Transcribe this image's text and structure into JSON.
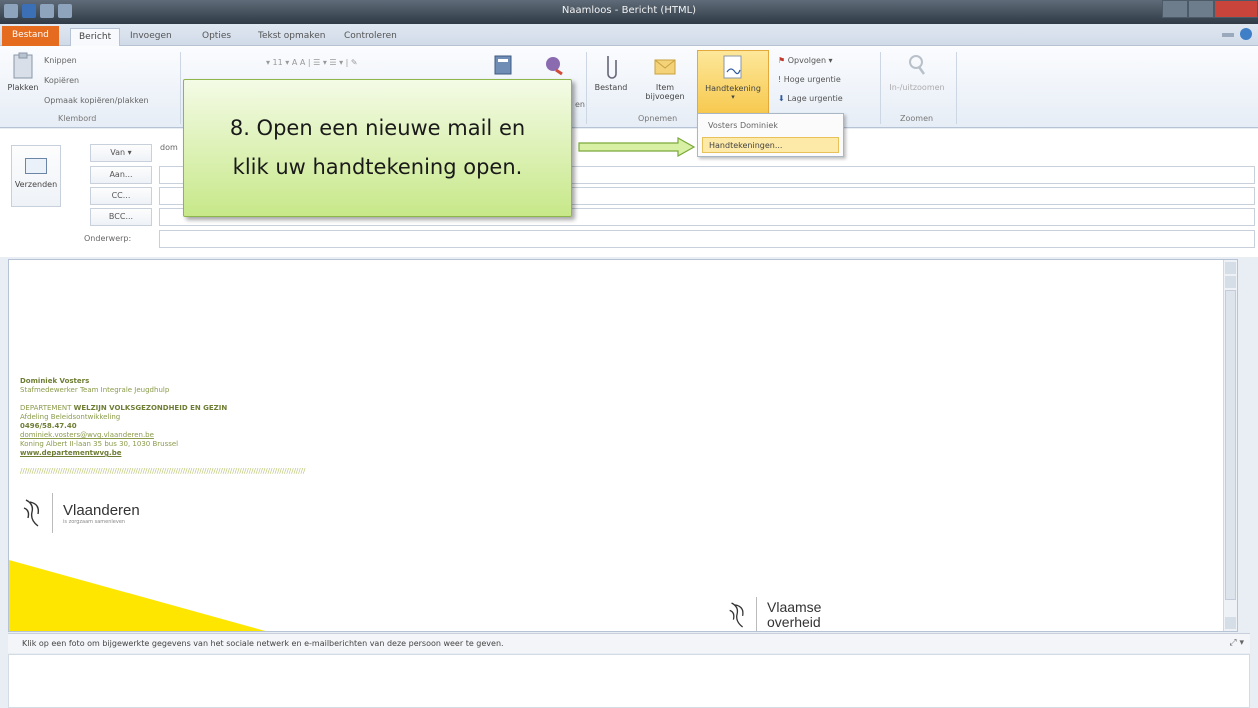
{
  "window": {
    "title": "Naamloos - Bericht (HTML)"
  },
  "tabs": [
    {
      "label": "Bestand"
    },
    {
      "label": "Bericht"
    },
    {
      "label": "Invoegen"
    },
    {
      "label": "Opties"
    },
    {
      "label": "Tekst opmaken"
    },
    {
      "label": "Controleren"
    }
  ],
  "ribbon": {
    "clipboard": {
      "paste": "Plakken",
      "cut": "Knippen",
      "copy": "Kopiëren",
      "format_painter": "Opmaak kopiëren/plakken",
      "label": "Klembord"
    },
    "include": {
      "attach_file": "Bestand",
      "attach_item": "Item bijvoegen",
      "signature": "Handtekening",
      "label": "Opnemen"
    },
    "tags": {
      "followup": "Opvolgen",
      "high": "Hoge urgentie",
      "low": "Lage urgentie"
    },
    "zoom": {
      "button": "In-/uitzoomen",
      "label": "Zoomen"
    },
    "partial": {
      "names": "en"
    }
  },
  "signature_menu": {
    "items": [
      "Vosters Dominiek",
      "Handtekeningen..."
    ]
  },
  "header": {
    "send": "Verzenden",
    "from": "Van",
    "from_value": "dom",
    "to": "Aan...",
    "cc": "CC...",
    "bcc": "BCC...",
    "subject": "Onderwerp:"
  },
  "signature": {
    "name": "Dominiek Vosters",
    "role": "Stafmedewerker Team Integrale Jeugdhulp",
    "dept_prefix": "DEPARTEMENT ",
    "dept": "WELZIJN VOLKSGEZONDHEID EN GEZIN",
    "division": "Afdeling Beleidsontwikkeling",
    "phone": "0496/58.47.40",
    "email": "dominiek.vosters@wvg.vlaanderen.be",
    "address": "Koning Albert II-laan 35 bus 30, 1030 Brussel",
    "website": "www.departementwvg.be",
    "dots": "/////////////////////////////////////////////////////////////////////////////////////////////////////////////////////////"
  },
  "logos": {
    "vlaanderen": "Vlaanderen",
    "vlaanderen_tagline": "is zorgzaam samenleven",
    "vlaamse": "Vlaamse",
    "overheid": "overheid"
  },
  "people_pane": {
    "text": "Klik op een foto om bijgewerkte gegevens van het sociale netwerk en e-mailberichten van deze persoon weer te geven."
  },
  "callout": {
    "line1": "8. Open een nieuwe mail en",
    "line2": "klik uw handtekening open."
  },
  "colors": {
    "accent_file_tab": "#e56b1f",
    "callout_green": "#c7e889",
    "signature_green": "#8a9b4a",
    "brand_yellow": "#ffe600"
  }
}
